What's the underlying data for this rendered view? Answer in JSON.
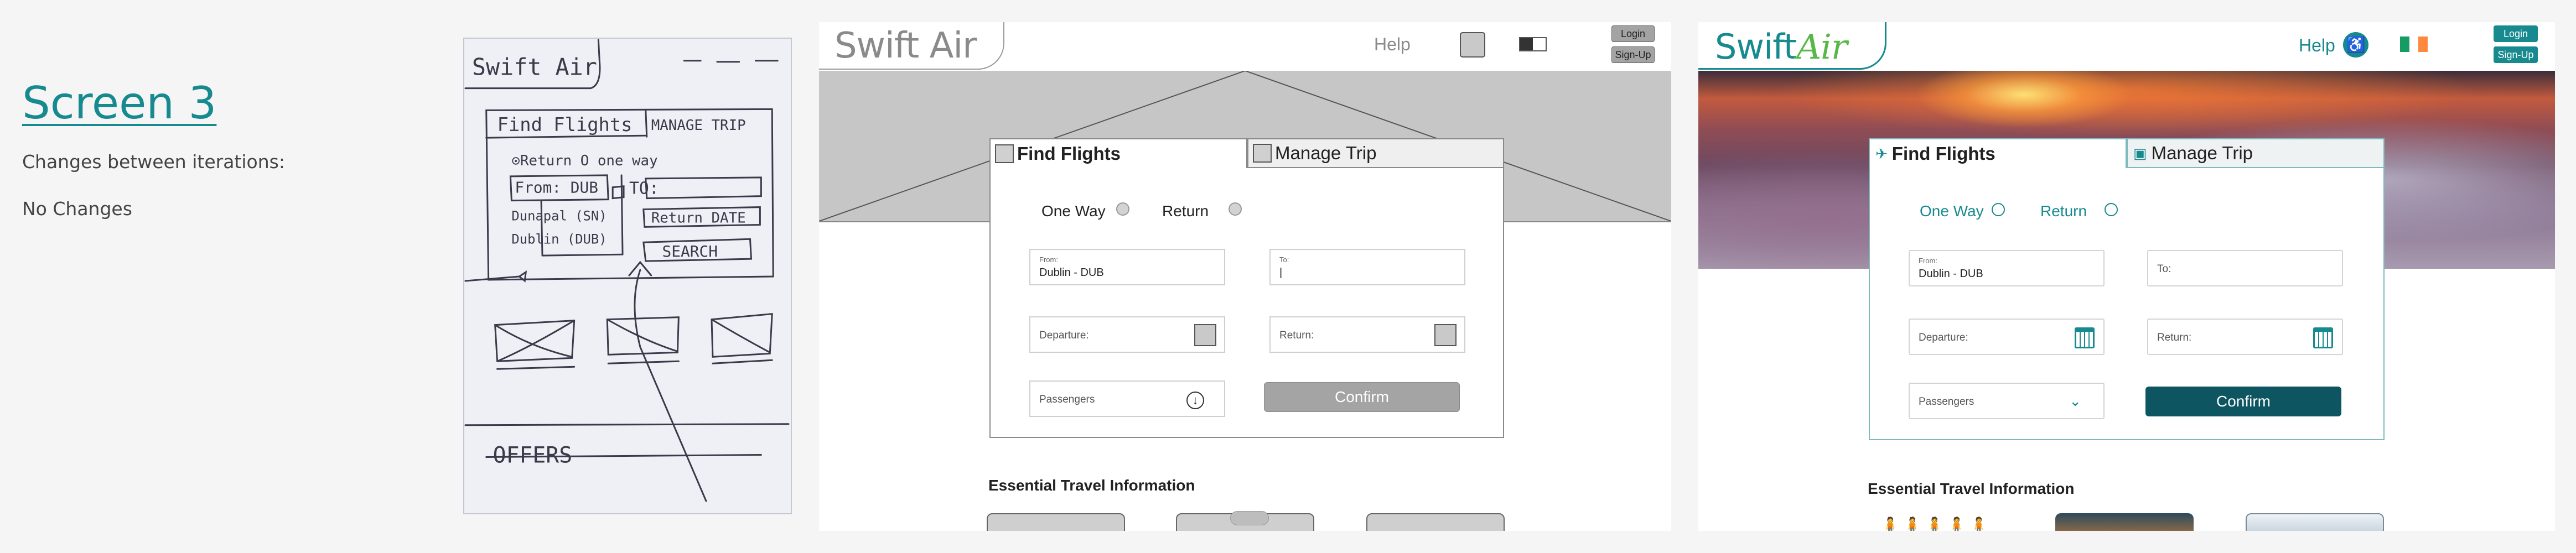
{
  "notes": {
    "title": "Screen 3",
    "subtitle": "Changes between iterations:",
    "body": "No Changes"
  },
  "sketch": {
    "logo": "Swift Air",
    "tab1": "Find Flights",
    "tab2": "MANAGE TRIP",
    "radios": "⊙Return  O one way",
    "from": "From: DUB",
    "to": "TO:",
    "dropdown1": "Dunapal (SN)",
    "dropdown2": "Dublin (DUB)",
    "return": "Return DATE",
    "search": "SEARCH",
    "offers": "OFFERS"
  },
  "wireframe": {
    "logo": "Swift Air",
    "help": "Help",
    "login": "Login",
    "signup": "Sign-Up",
    "tab_find": "Find Flights",
    "tab_manage": "Manage Trip",
    "one_way": "One Way",
    "return": "Return",
    "from_label": "From:",
    "from_value": "Dublin - DUB",
    "to_label": "To:",
    "departure_placeholder": "Departure:",
    "return_placeholder": "Return:",
    "passengers": "Passengers",
    "confirm": "Confirm",
    "essential": "Essential Travel Information"
  },
  "final": {
    "logo_swift": "Swift",
    "logo_air": "Air",
    "help": "Help",
    "login": "Login",
    "signup": "Sign-Up",
    "tab_find": "Find Flights",
    "tab_manage": "Manage Trip",
    "one_way": "One Way",
    "return": "Return",
    "from_label": "From:",
    "from_value": "Dublin - DUB",
    "to_placeholder": "To:",
    "departure_placeholder": "Departure:",
    "return_placeholder": "Return:",
    "passengers": "Passengers",
    "confirm": "Confirm",
    "essential": "Essential Travel Information",
    "colors": {
      "brand": "#178a8f",
      "confirm": "#0c5561",
      "logo_air": "#57b847"
    }
  }
}
